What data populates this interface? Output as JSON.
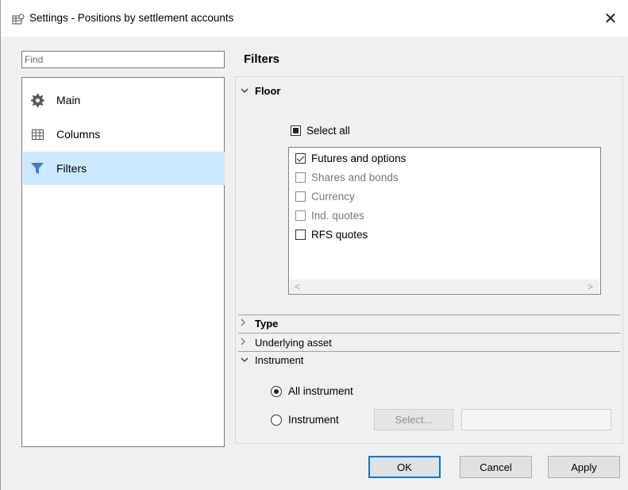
{
  "window": {
    "title": "Settings - Positions by settlement accounts",
    "close_glyph": "✕"
  },
  "search": {
    "placeholder": "Find"
  },
  "nav": {
    "items": [
      {
        "label": "Main",
        "icon": "gear-icon"
      },
      {
        "label": "Columns",
        "icon": "table-icon"
      },
      {
        "label": "Filters",
        "icon": "funnel-icon",
        "active": true
      }
    ]
  },
  "section": {
    "title": "Filters"
  },
  "filters": {
    "floor": {
      "label": "Floor",
      "expanded": true,
      "select_all": "Select all",
      "items": [
        {
          "label": "Futures and options",
          "checked": true
        },
        {
          "label": "Shares and bonds",
          "checked": false
        },
        {
          "label": "Currency",
          "checked": false
        },
        {
          "label": "Ind. quotes",
          "checked": false
        },
        {
          "label": "RFS quotes",
          "checked": false
        }
      ],
      "scroll_left": "<",
      "scroll_right": ">"
    },
    "type": {
      "label": "Type",
      "expanded": false
    },
    "underlying": {
      "label": "Underlying asset",
      "expanded": false
    },
    "instrument": {
      "label": "Instrument",
      "expanded": true,
      "options": [
        {
          "label": "All instrument",
          "selected": true
        },
        {
          "label": "Instrument",
          "selected": false
        }
      ],
      "select_button": "Select...",
      "field_value": ""
    }
  },
  "footer": {
    "ok": "OK",
    "cancel": "Cancel",
    "apply": "Apply"
  },
  "colors": {
    "accent": "#0078d7",
    "selection": "#cce8ff",
    "funnel": "#3b7fc4"
  }
}
